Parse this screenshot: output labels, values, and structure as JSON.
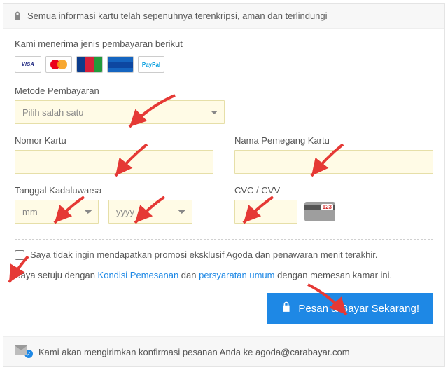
{
  "header": {
    "secure_text": "Semua informasi kartu telah sepenuhnya terenkripsi, aman dan terlindungi"
  },
  "accept_text": "Kami menerima jenis pembayaran berikut",
  "payment_method": {
    "label": "Metode Pembayaran",
    "placeholder": "Pilih salah satu"
  },
  "card_number": {
    "label": "Nomor Kartu"
  },
  "card_name": {
    "label": "Nama Pemegang Kartu"
  },
  "expiry": {
    "label": "Tanggal Kadaluwarsa",
    "mm": "mm",
    "yyyy": "yyyy"
  },
  "cvc": {
    "label": "CVC / CVV",
    "tag": "123"
  },
  "promo_checkbox": "Saya tidak ingin mendapatkan promosi eksklusif Agoda dan penawaran menit terakhir.",
  "terms": {
    "pre": "Saya setuju dengan ",
    "link1": "Kondisi Pemesanan",
    "mid": " dan ",
    "link2": "persyaratan umum",
    "post": " dengan memesan kamar ini."
  },
  "button": "Pesan & Bayar Sekarang!",
  "footer": {
    "text": "Kami akan mengirimkan konfirmasi pesanan Anda ke agoda@carabayar.com"
  },
  "cards": {
    "visa": "VISA",
    "paypal_a": "Pay",
    "paypal_b": "Pal"
  }
}
